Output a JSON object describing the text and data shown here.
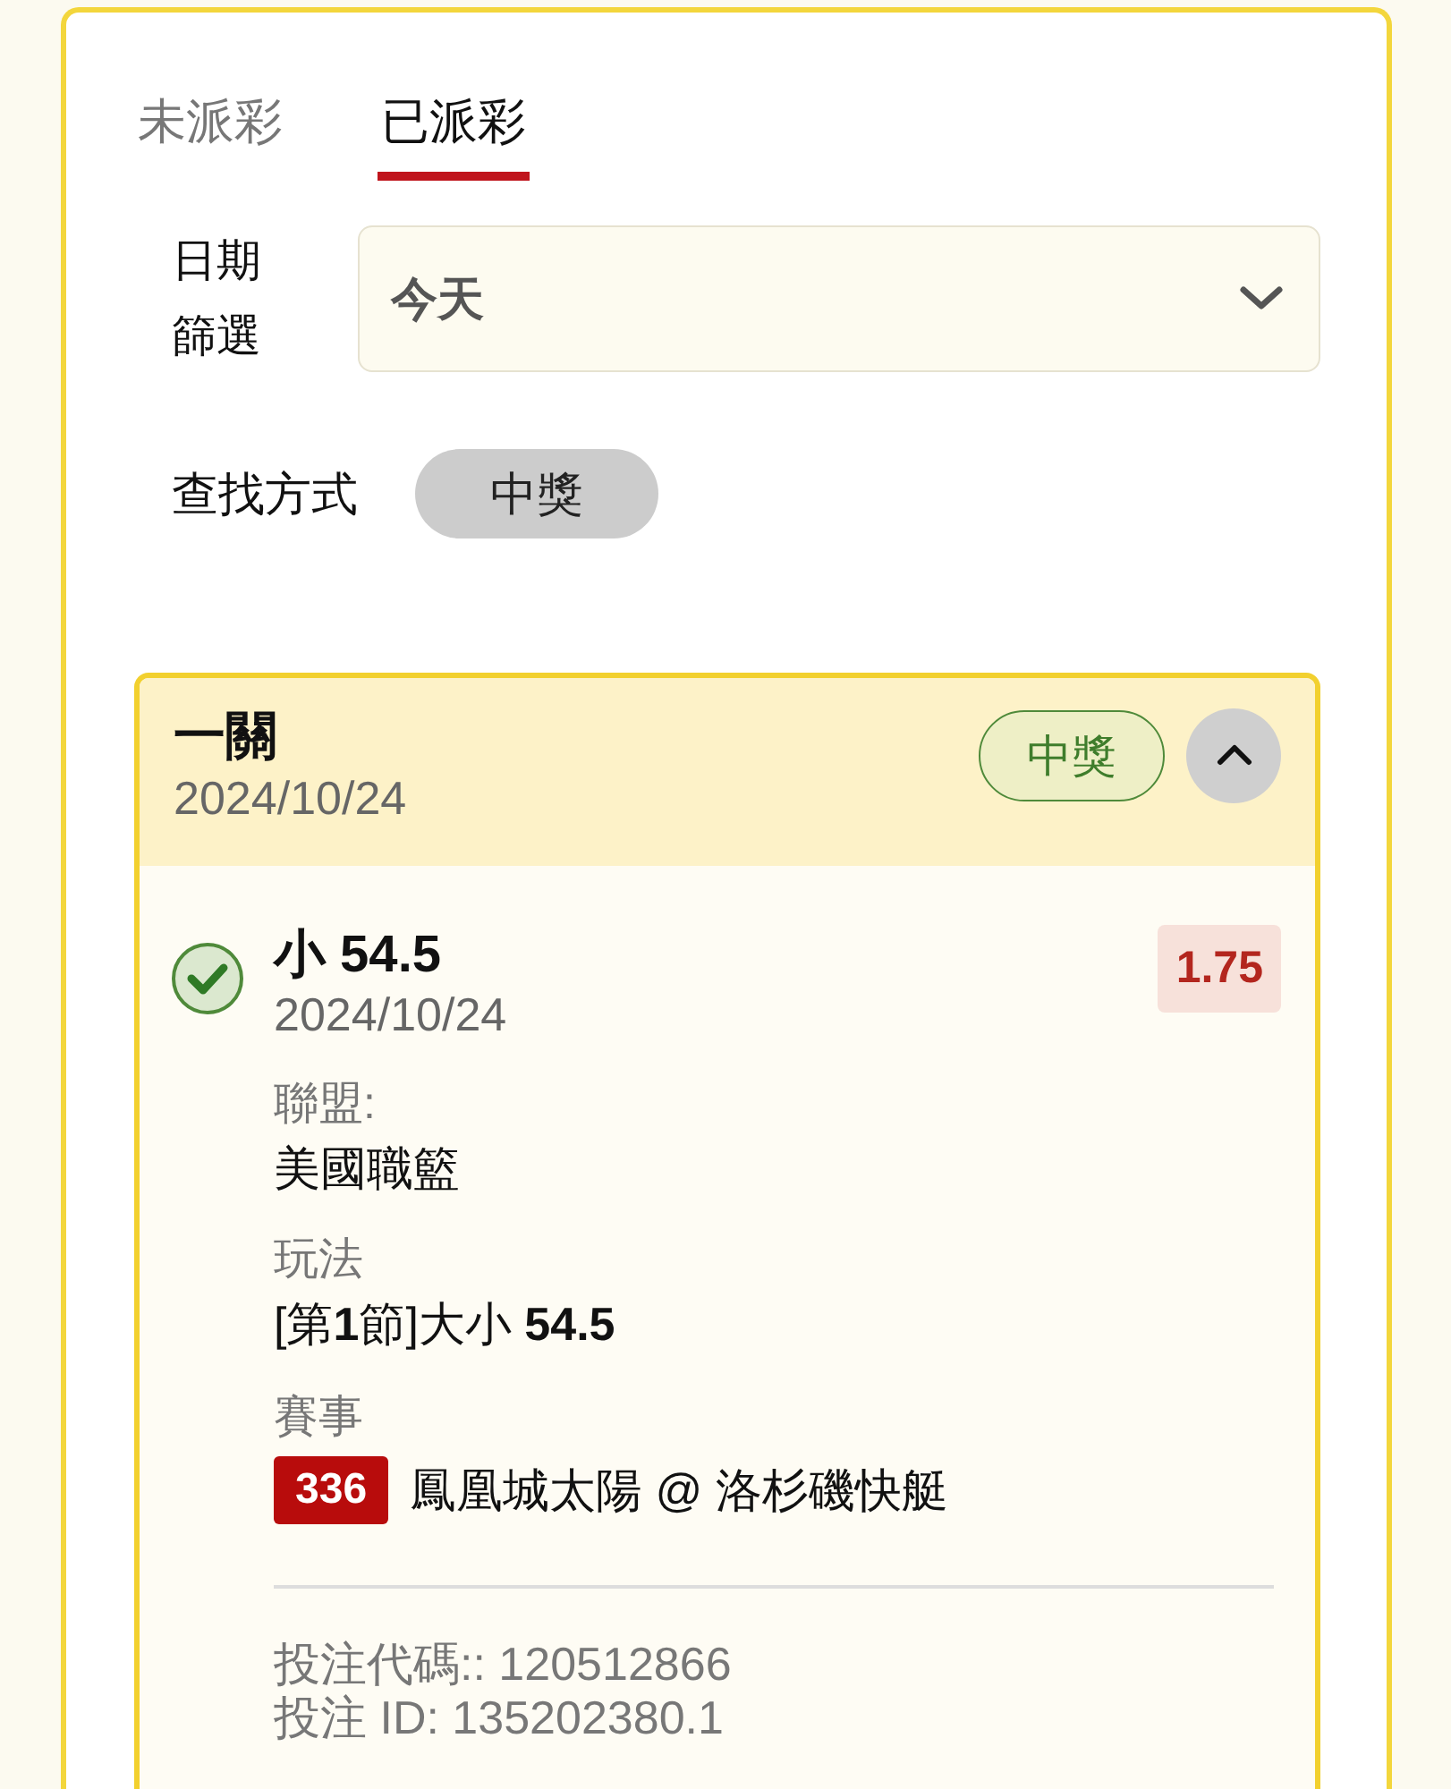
{
  "tabs": [
    {
      "label": "未派彩",
      "selected": false
    },
    {
      "label": "已派彩",
      "selected": true
    }
  ],
  "date_filter": {
    "label": "日期篩選",
    "value": "今天"
  },
  "search": {
    "label": "查找方式",
    "chips": [
      {
        "label": "中獎",
        "selected": true
      }
    ]
  },
  "bets": [
    {
      "type": "一關",
      "date": "2024/10/24",
      "status": {
        "label": "中獎",
        "kind": "won"
      },
      "expanded": true,
      "selections": [
        {
          "won": true,
          "title": "小 54.5",
          "date": "2024/10/24",
          "odds": "1.75",
          "details": [
            {
              "kind": "text",
              "label": "聯盟:",
              "value": "美國職籃"
            },
            {
              "kind": "text",
              "label": "玩法",
              "value": "[第**1**節]大小 **54.5**"
            },
            {
              "kind": "match",
              "label": "賽事",
              "number": "336",
              "value": "鳳凰城太陽 @ 洛杉磯快艇"
            }
          ]
        }
      ],
      "codes": [
        "投注代碼:: 120512866",
        "投注 ID: 135202380.1"
      ]
    }
  ]
}
